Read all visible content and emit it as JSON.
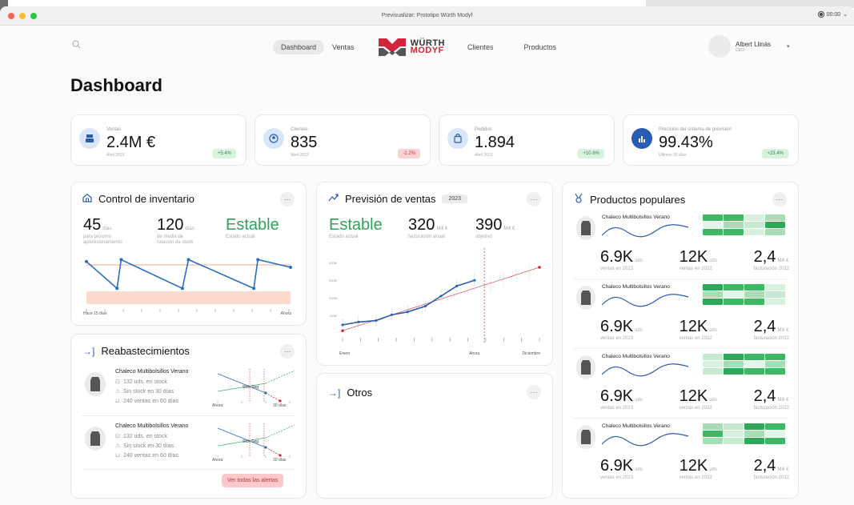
{
  "window": {
    "title": "Previsualizar: Prototipo Würth Modyf",
    "clock": "00:00"
  },
  "nav": {
    "dashboard": "Dashboard",
    "ventas": "Ventas",
    "clientes": "Clientes",
    "productos": "Productos",
    "logo_top": "WÜRTH",
    "logo_bottom": "MODYF"
  },
  "user": {
    "name": "Albert Llinás",
    "role": "CEO"
  },
  "page": {
    "title": "Dashboard"
  },
  "colors": {
    "accent": "#2a5db0",
    "brand_red": "#d3253a",
    "green": "#30a05a"
  },
  "kpis": [
    {
      "label": "Ventas",
      "value": "2.4M €",
      "sub": "Abril 2023",
      "badge": "+5.4%",
      "icon": "register-icon"
    },
    {
      "label": "Clientes",
      "value": "835",
      "sub": "Abril 2023",
      "badge": "-1.2%",
      "icon": "user-circle-icon"
    },
    {
      "label": "Pedidos",
      "value": "1.894",
      "sub": "Abril 2023",
      "badge": "+10.6%",
      "icon": "bag-icon"
    },
    {
      "label": "Precisión del sistema de previsión",
      "value": "99.43%",
      "sub": "Últimos 30 días",
      "badge": "+23.4%",
      "icon": "bar-chart-icon"
    }
  ],
  "inventario": {
    "title": "Control de inventario",
    "s1_value": "45",
    "s1_unit": "días",
    "s1_desc1": "para próximo",
    "s1_desc2": "aprovisionamiento",
    "s2_value": "120",
    "s2_unit": "días",
    "s2_desc1": "de media de",
    "s2_desc2": "rotación de stock",
    "s3_value": "Estable",
    "s3_desc": "Estado actual",
    "x_start": "Hace 15 días",
    "x_end": "Ahora"
  },
  "prevision": {
    "title": "Previsión de ventas",
    "year": "2023",
    "s1_value": "Estable",
    "s1_desc": "Estado actual",
    "s2_value": "320",
    "s2_unit": "Mill €",
    "s2_desc": "facturación anual",
    "s3_value": "390",
    "s3_unit": "Mill €",
    "s3_desc": "objetivo",
    "y_ticks": [
      "400M",
      "300M",
      "200M",
      "100M"
    ],
    "x_start": "Enero",
    "x_mid": "Ahora",
    "x_end": "Diciembre"
  },
  "reabastecimientos": {
    "title": "Reabastecimientos",
    "items": [
      {
        "name": "Chaleco Multibolsillos Verano",
        "stock": "132 uds. en stock",
        "sin_stock": "Sin stock en 30 días",
        "ventas": "240 ventas en 60 días",
        "chart_label": "Stck Seg",
        "x_start": "Ahora",
        "x_end": "30 días"
      },
      {
        "name": "Chaleco Multibolsillos Verano",
        "stock": "132 uds. en stock",
        "sin_stock": "Sin stock en 30 días",
        "ventas": "240 ventas en 60 días",
        "chart_label": "Stck Seg",
        "x_start": "Ahora",
        "x_end": "30 días"
      }
    ],
    "button": "Ver todas las alertas"
  },
  "otros": {
    "title": "Otros"
  },
  "populares": {
    "title": "Productos populares",
    "items": [
      {
        "name": "Chaleco Multibolsillos Verano",
        "v1": "6.9K",
        "u1": "uds",
        "d1": "ventas en 2023",
        "v2": "12K",
        "u2": "uds",
        "d2": "ventas en 2022",
        "v3": "2,4",
        "u3": "Mill €",
        "d3": "facturación 2022"
      },
      {
        "name": "Chaleco Multibolsillos Verano",
        "v1": "6.9K",
        "u1": "uds",
        "d1": "ventas en 2023",
        "v2": "12K",
        "u2": "uds",
        "d2": "ventas en 2022",
        "v3": "2,4",
        "u3": "Mill €",
        "d3": "facturación 2022"
      },
      {
        "name": "Chaleco Multibolsillos Verano",
        "v1": "6.9K",
        "u1": "uds",
        "d1": "ventas en 2023",
        "v2": "12K",
        "u2": "uds",
        "d2": "ventas en 2022",
        "v3": "2,4",
        "u3": "Mill €",
        "d3": "facturación 2022"
      },
      {
        "name": "Chaleco Multibolsillos Verano",
        "v1": "6.9K",
        "u1": "uds",
        "d1": "ventas en 2023",
        "v2": "12K",
        "u2": "uds",
        "d2": "ventas en 2022",
        "v3": "2,4",
        "u3": "Mill €",
        "d3": "facturación 2022"
      }
    ]
  },
  "charts": {
    "inventario_points": [
      [
        0,
        0.1
      ],
      [
        0.15,
        0.8
      ],
      [
        0.17,
        0.05
      ],
      [
        0.47,
        0.8
      ],
      [
        0.5,
        0.05
      ],
      [
        0.82,
        0.8
      ],
      [
        0.84,
        0.05
      ],
      [
        1,
        0.25
      ]
    ],
    "prevision_actual": [
      [
        0,
        0.1
      ],
      [
        0.08,
        0.14
      ],
      [
        0.17,
        0.16
      ],
      [
        0.25,
        0.24
      ],
      [
        0.33,
        0.28
      ],
      [
        0.42,
        0.36
      ],
      [
        0.5,
        0.5
      ],
      [
        0.58,
        0.64
      ],
      [
        0.67,
        0.72
      ]
    ],
    "prevision_trend": [
      [
        0,
        0.02
      ],
      [
        1,
        0.9
      ]
    ]
  }
}
